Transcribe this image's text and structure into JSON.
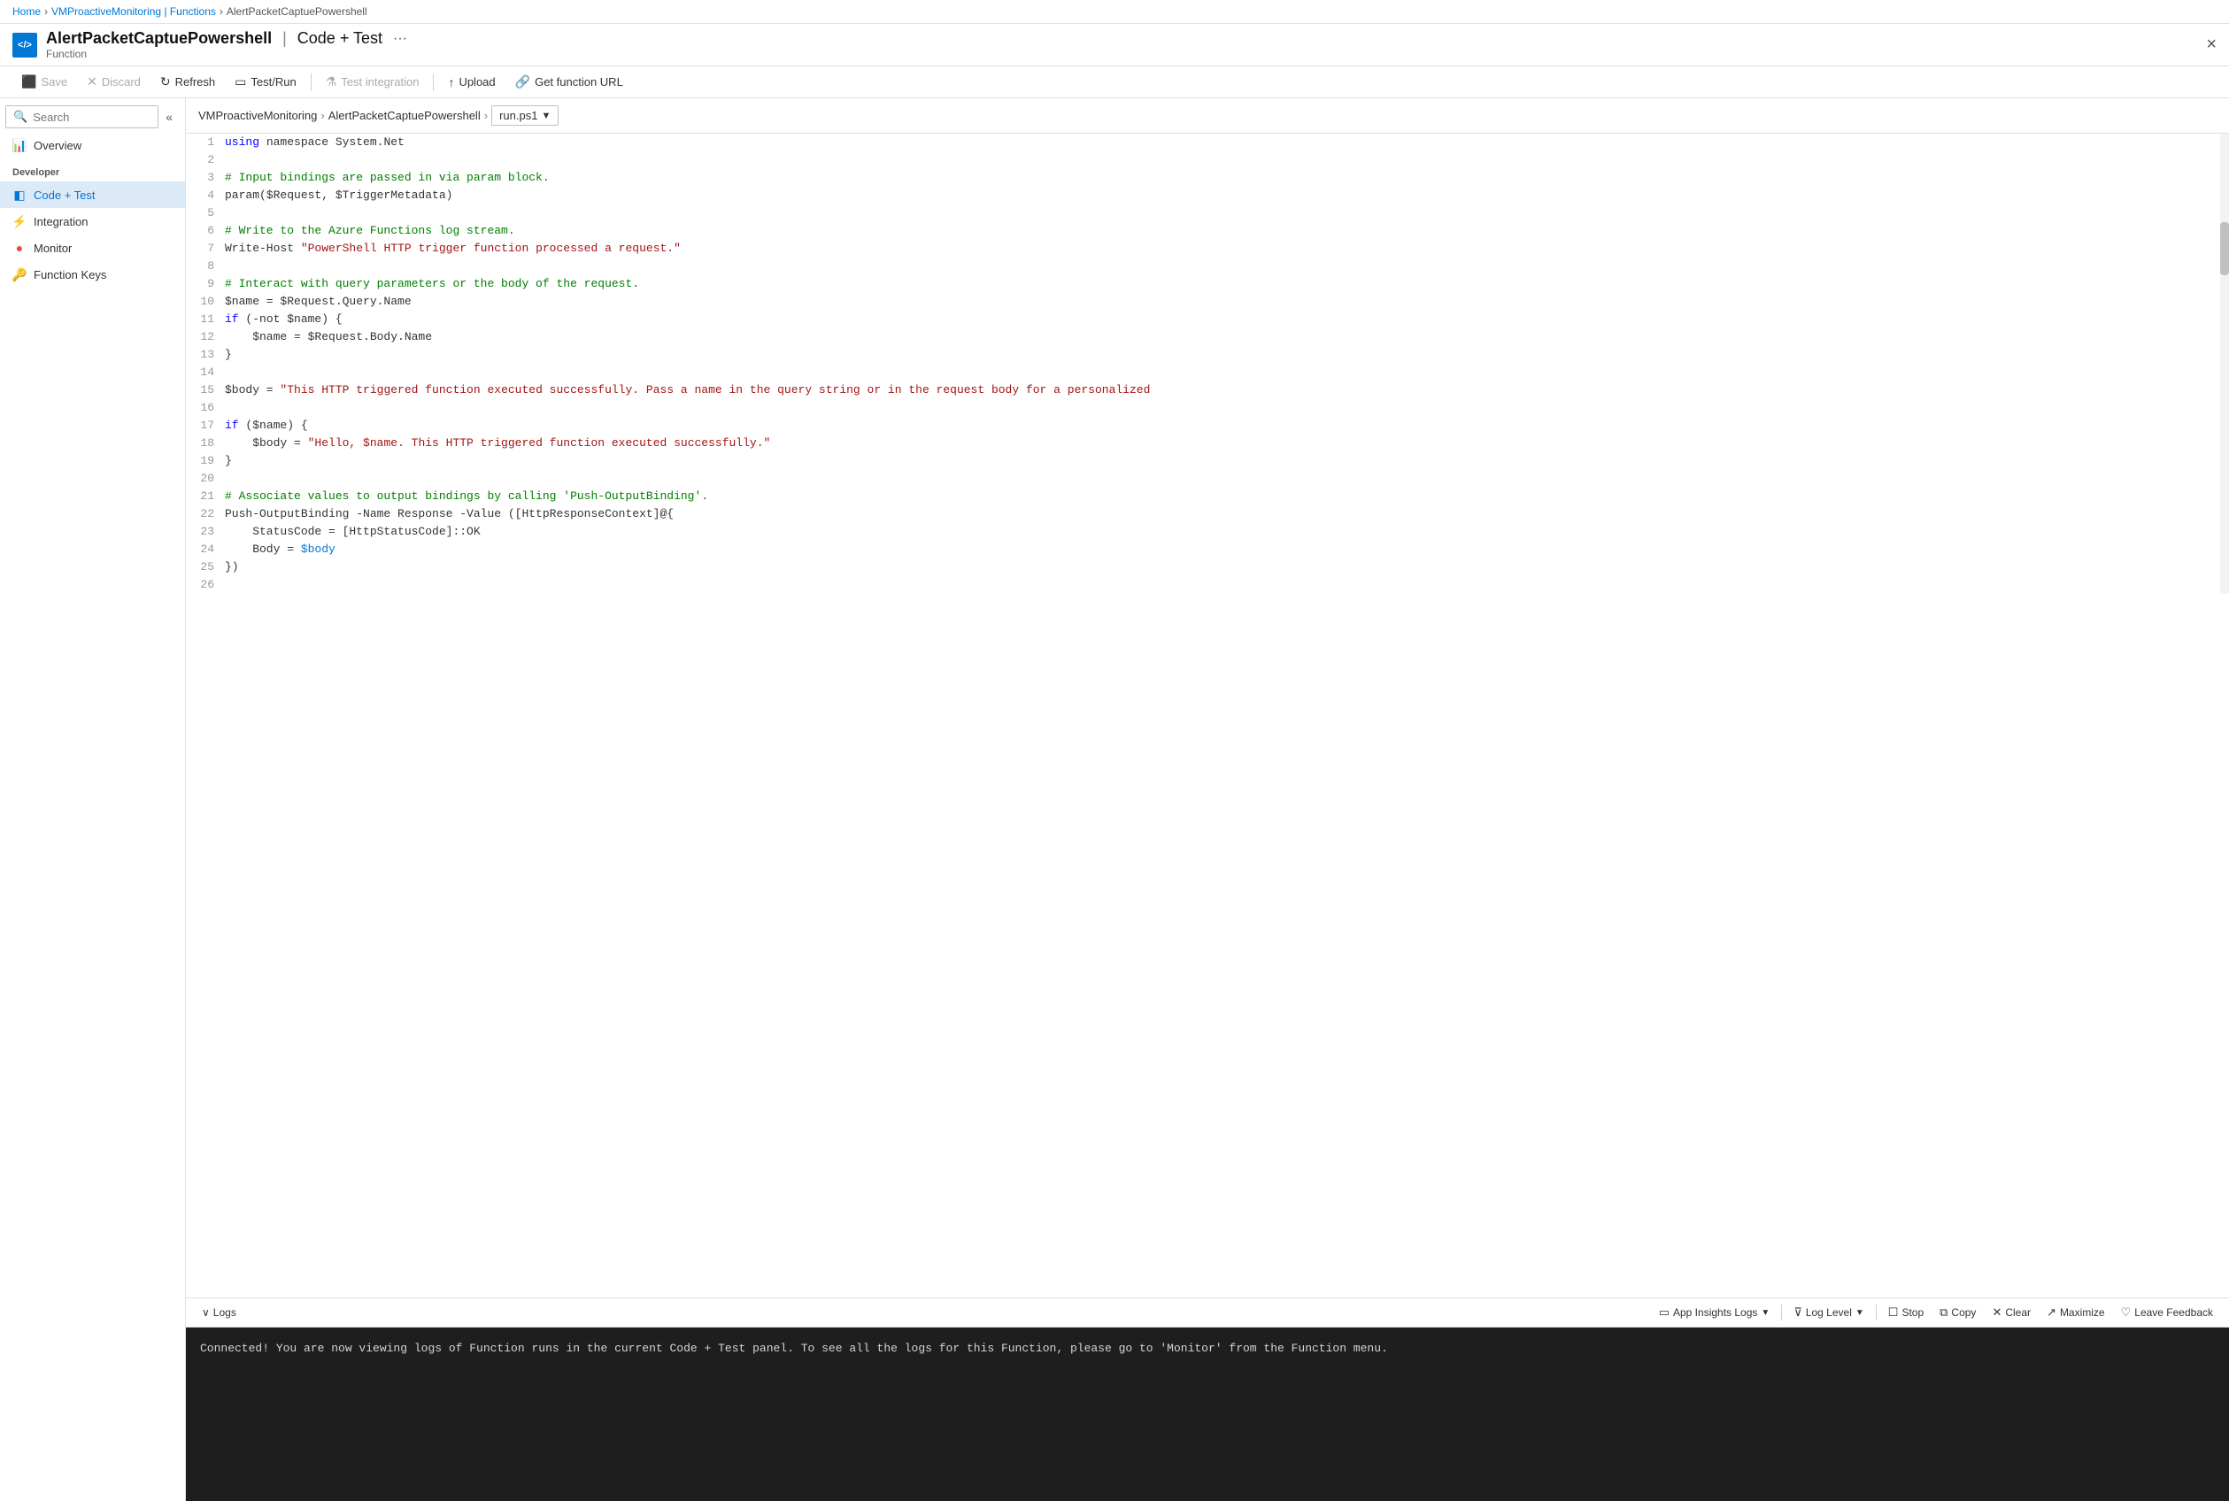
{
  "breadcrumb": {
    "items": [
      "Home",
      "VMProactiveMonitoring | Functions",
      "AlertPacketCaptuePowershell"
    ]
  },
  "title": {
    "app_icon": "</>",
    "function_name": "AlertPacketCaptuePowershell",
    "separator": "|",
    "view_name": "Code + Test",
    "subtitle": "Function",
    "ellipsis": "···",
    "close_label": "×"
  },
  "toolbar": {
    "save": "Save",
    "discard": "Discard",
    "refresh": "Refresh",
    "test_run": "Test/Run",
    "test_integration": "Test integration",
    "upload": "Upload",
    "get_function_url": "Get function URL"
  },
  "sidebar": {
    "search_placeholder": "Search",
    "overview_label": "Overview",
    "developer_section": "Developer",
    "items": [
      {
        "id": "code-test",
        "label": "Code + Test",
        "icon": "◧",
        "active": true
      },
      {
        "id": "integration",
        "label": "Integration",
        "icon": "⚡",
        "active": false
      },
      {
        "id": "monitor",
        "label": "Monitor",
        "icon": "🔴",
        "active": false
      },
      {
        "id": "function-keys",
        "label": "Function Keys",
        "icon": "🔑",
        "active": false
      }
    ]
  },
  "file_path": {
    "parts": [
      "VMProactiveMonitoring",
      "AlertPacketCaptuePowershell"
    ],
    "file": "run.ps1"
  },
  "code_lines": [
    {
      "num": 1,
      "tokens": [
        {
          "t": "kw",
          "v": "using"
        },
        {
          "t": "plain",
          "v": " namespace System.Net"
        }
      ]
    },
    {
      "num": 2,
      "tokens": []
    },
    {
      "num": 3,
      "tokens": [
        {
          "t": "cm",
          "v": "# Input bindings are passed in via param block."
        }
      ]
    },
    {
      "num": 4,
      "tokens": [
        {
          "t": "plain",
          "v": "param($Request, $TriggerMetadata)"
        }
      ]
    },
    {
      "num": 5,
      "tokens": []
    },
    {
      "num": 6,
      "tokens": [
        {
          "t": "cm",
          "v": "# Write to the Azure Functions log stream."
        }
      ]
    },
    {
      "num": 7,
      "tokens": [
        {
          "t": "plain",
          "v": "Write-Host "
        },
        {
          "t": "str",
          "v": "\"PowerShell HTTP trigger function processed a request.\""
        }
      ]
    },
    {
      "num": 8,
      "tokens": []
    },
    {
      "num": 9,
      "tokens": [
        {
          "t": "cm",
          "v": "# Interact with query parameters or the body of the request."
        }
      ]
    },
    {
      "num": 10,
      "tokens": [
        {
          "t": "plain",
          "v": "$name = $Request.Query.Name"
        }
      ]
    },
    {
      "num": 11,
      "tokens": [
        {
          "t": "kw",
          "v": "if"
        },
        {
          "t": "plain",
          "v": " (-not $name) {"
        }
      ]
    },
    {
      "num": 12,
      "tokens": [
        {
          "t": "plain",
          "v": "    $name = $Request.Body.Name"
        }
      ]
    },
    {
      "num": 13,
      "tokens": [
        {
          "t": "plain",
          "v": "}"
        }
      ]
    },
    {
      "num": 14,
      "tokens": []
    },
    {
      "num": 15,
      "tokens": [
        {
          "t": "plain",
          "v": "$body = "
        },
        {
          "t": "str",
          "v": "\"This HTTP triggered function executed successfully. Pass a name in the query string or in the request body for a personalized"
        }
      ]
    },
    {
      "num": 16,
      "tokens": []
    },
    {
      "num": 17,
      "tokens": [
        {
          "t": "kw",
          "v": "if"
        },
        {
          "t": "plain",
          "v": " ($name) {"
        }
      ]
    },
    {
      "num": 18,
      "tokens": [
        {
          "t": "plain",
          "v": "    $body = "
        },
        {
          "t": "str",
          "v": "\"Hello, $name. This HTTP triggered function executed successfully.\""
        }
      ]
    },
    {
      "num": 19,
      "tokens": [
        {
          "t": "plain",
          "v": "}"
        }
      ]
    },
    {
      "num": 20,
      "tokens": []
    },
    {
      "num": 21,
      "tokens": [
        {
          "t": "cm",
          "v": "# Associate values to output bindings by calling 'Push-OutputBinding'."
        }
      ]
    },
    {
      "num": 22,
      "tokens": [
        {
          "t": "plain",
          "v": "Push-OutputBinding -Name Response -Value ([HttpResponseContext]@{"
        }
      ]
    },
    {
      "num": 23,
      "tokens": [
        {
          "t": "plain",
          "v": "    StatusCode = [HttpStatusCode]::OK"
        }
      ]
    },
    {
      "num": 24,
      "tokens": [
        {
          "t": "plain",
          "v": "    Body = "
        },
        {
          "t": "var",
          "v": "$body"
        }
      ]
    },
    {
      "num": 25,
      "tokens": [
        {
          "t": "plain",
          "v": "})"
        }
      ]
    },
    {
      "num": 26,
      "tokens": []
    }
  ],
  "logs": {
    "toggle_label": "Logs",
    "app_insights": "App Insights Logs",
    "log_level": "Log Level",
    "stop": "Stop",
    "copy": "Copy",
    "clear": "Clear",
    "maximize": "Maximize",
    "leave_feedback": "Leave Feedback",
    "content": "Connected! You are now viewing logs of Function runs in the current Code + Test panel. To see all the logs for this Function, please go to\n'Monitor' from the Function menu."
  }
}
